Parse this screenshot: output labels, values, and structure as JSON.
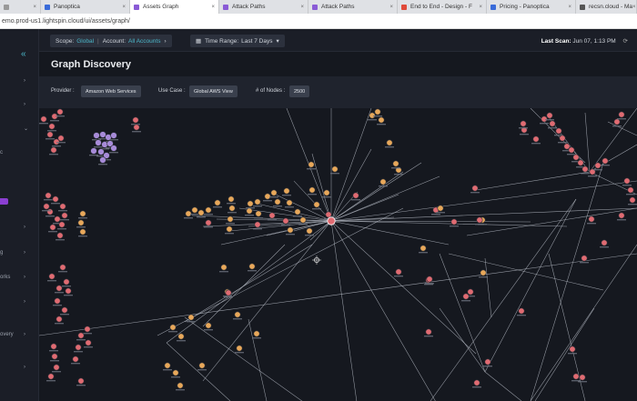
{
  "browser": {
    "tabs": [
      {
        "label": "",
        "color": "#999999",
        "active": false
      },
      {
        "label": "Panoptica",
        "color": "#3a6bd9",
        "active": false
      },
      {
        "label": "Assets Graph",
        "color": "#8a5bd6",
        "active": true
      },
      {
        "label": "Attack Paths",
        "color": "#8a5bd6",
        "active": false
      },
      {
        "label": "Attack Paths",
        "color": "#8a5bd6",
        "active": false
      },
      {
        "label": "End to End - Design - F",
        "color": "#e04a3a",
        "active": false
      },
      {
        "label": "Pricing - Panoptica",
        "color": "#3a6bd9",
        "active": false
      },
      {
        "label": "recsn.cloud - Ma",
        "color": "#555555",
        "active": false
      }
    ],
    "url": "emo.prod-us1.lightspin.cloud/ui/assets/graph/"
  },
  "sidebar": {
    "collapse_icon": "«",
    "items": [
      "",
      "",
      "c",
      "",
      "",
      "g",
      "orks",
      "",
      "overy"
    ]
  },
  "topbar": {
    "scope_label": "Scope:",
    "scope_value": "Global",
    "account_label": "Account:",
    "account_value": "All Accounts",
    "time_range_label": "Time Range:",
    "time_range_value": "Last 7 Days",
    "last_scan_label": "Last Scan:",
    "last_scan_value": "Jun 07, 1:13 PM"
  },
  "page": {
    "title": "Graph Discovery"
  },
  "filters": {
    "provider_label": "Provider :",
    "provider_value": "Amazon Web Services",
    "use_case_label": "Use Case :",
    "use_case_value": "Global AWS View",
    "nodes_label": "# of Nodes :",
    "nodes_value": "2500"
  },
  "graph": {
    "colors": {
      "background": "#15181f",
      "edge": "#b9bec8",
      "node_red": "#e06b72",
      "node_orange": "#e8a85a",
      "node_purple": "#a78bd8",
      "node_stroke": "#2a2d35"
    }
  }
}
